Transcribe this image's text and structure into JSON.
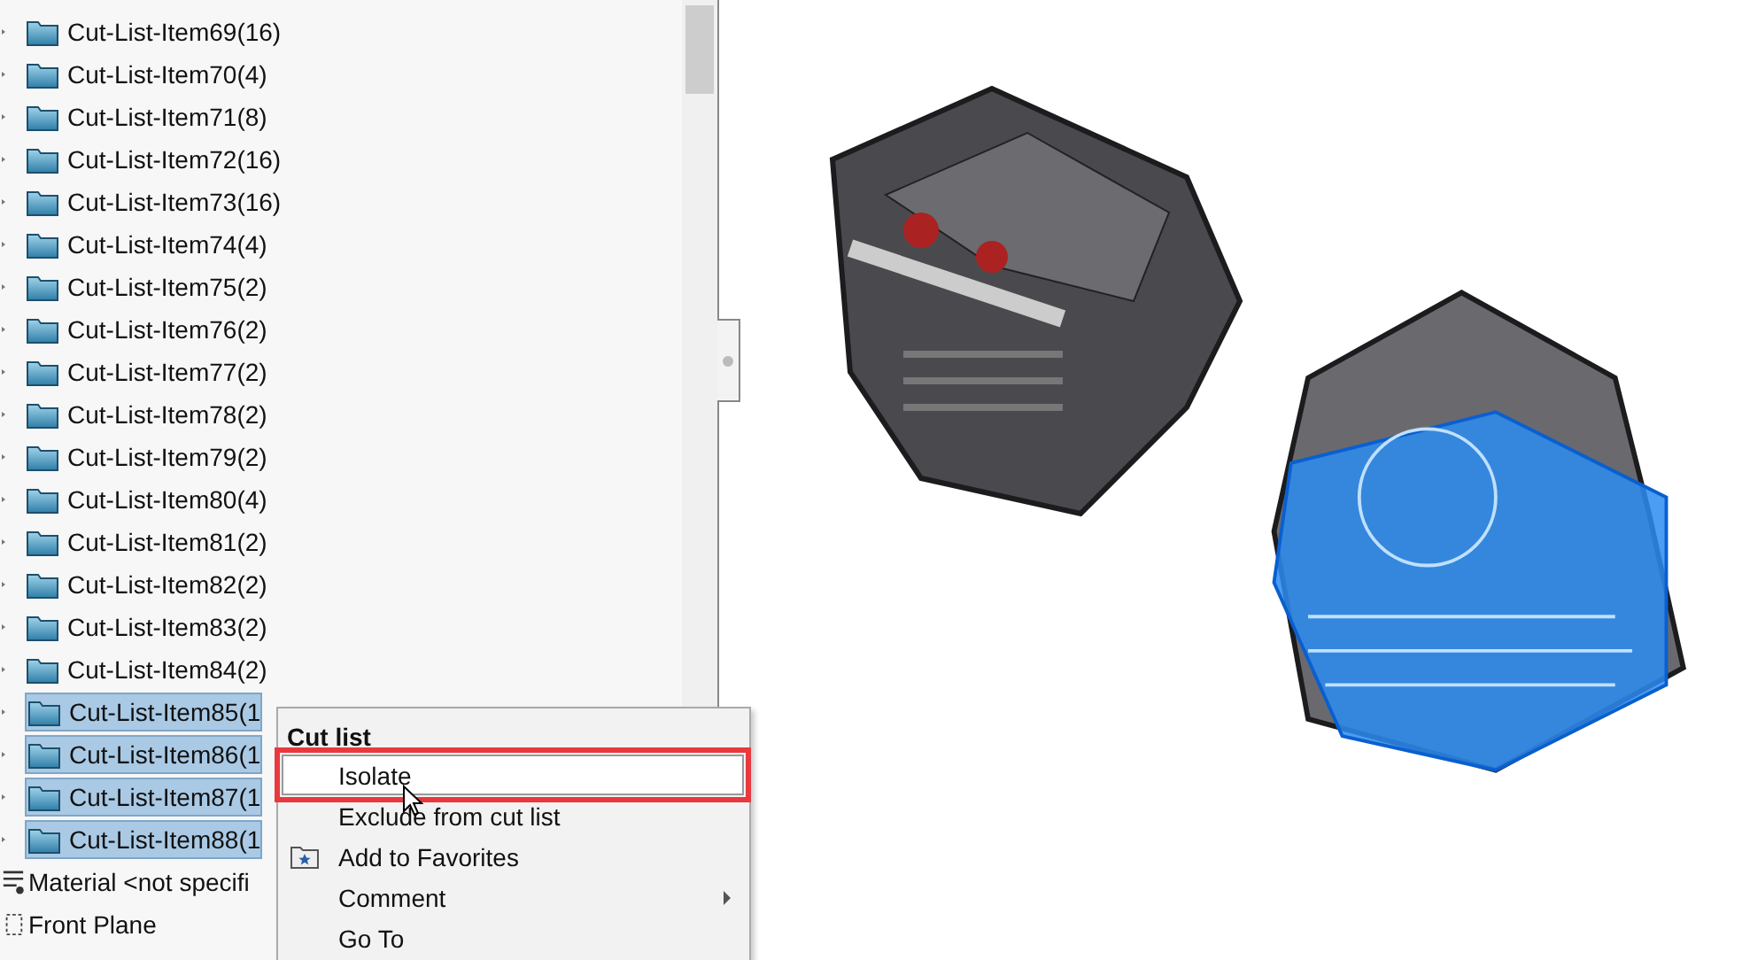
{
  "tree": {
    "items": [
      {
        "label": "Cut-List-Item69(16)",
        "selected": false
      },
      {
        "label": "Cut-List-Item70(4)",
        "selected": false
      },
      {
        "label": "Cut-List-Item71(8)",
        "selected": false
      },
      {
        "label": "Cut-List-Item72(16)",
        "selected": false
      },
      {
        "label": "Cut-List-Item73(16)",
        "selected": false
      },
      {
        "label": "Cut-List-Item74(4)",
        "selected": false
      },
      {
        "label": "Cut-List-Item75(2)",
        "selected": false
      },
      {
        "label": "Cut-List-Item76(2)",
        "selected": false
      },
      {
        "label": "Cut-List-Item77(2)",
        "selected": false
      },
      {
        "label": "Cut-List-Item78(2)",
        "selected": false
      },
      {
        "label": "Cut-List-Item79(2)",
        "selected": false
      },
      {
        "label": "Cut-List-Item80(4)",
        "selected": false
      },
      {
        "label": "Cut-List-Item81(2)",
        "selected": false
      },
      {
        "label": "Cut-List-Item82(2)",
        "selected": false
      },
      {
        "label": "Cut-List-Item83(2)",
        "selected": false
      },
      {
        "label": "Cut-List-Item84(2)",
        "selected": false
      },
      {
        "label": "Cut-List-Item85(1",
        "selected": true
      },
      {
        "label": "Cut-List-Item86(1",
        "selected": true
      },
      {
        "label": "Cut-List-Item87(1",
        "selected": true
      },
      {
        "label": "Cut-List-Item88(1",
        "selected": true
      }
    ],
    "features": [
      {
        "kind": "material",
        "label": "Material <not specifi"
      },
      {
        "kind": "plane",
        "label": "Front Plane"
      }
    ]
  },
  "context_menu": {
    "title": "Cut list",
    "items": [
      {
        "label": "Isolate",
        "selected": true,
        "kind": "plain"
      },
      {
        "label": "Exclude from cut list",
        "selected": false,
        "kind": "plain"
      },
      {
        "label": "Add to Favorites",
        "selected": false,
        "kind": "favorite"
      },
      {
        "label": "Comment",
        "selected": false,
        "kind": "submenu"
      },
      {
        "label": "Go To",
        "selected": false,
        "kind": "plain"
      }
    ]
  }
}
